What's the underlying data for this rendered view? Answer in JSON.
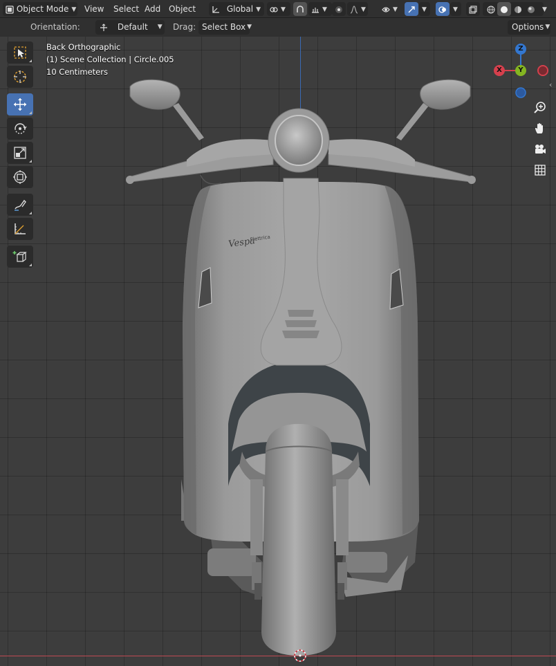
{
  "header": {
    "mode": "Object Mode",
    "menus": [
      "View",
      "Select",
      "Add",
      "Object"
    ],
    "transform_orientation": "Global",
    "icons": [
      "editor-type-icon",
      "object-mode-icon",
      "transform-orientation-icon",
      "pivot-icon",
      "snap-icon",
      "snap-increment-icon",
      "proportional-icon",
      "falloff-icon",
      "visibility-icon",
      "gizmo-icon",
      "overlay-icon",
      "xray-icon",
      "shading-wireframe-icon",
      "shading-solid-icon",
      "shading-material-icon",
      "shading-rendered-icon"
    ]
  },
  "tool_settings": {
    "orientation_label": "Orientation:",
    "orientation_value": "Default",
    "drag_label": "Drag:",
    "drag_value": "Select Box",
    "options_label": "Options"
  },
  "viewport": {
    "view_name": "Back Orthographic",
    "collection_info": "(1) Scene Collection | Circle.005",
    "scale_info": "10 Centimeters",
    "gizmo": {
      "z": "Z",
      "x": "X",
      "y": "Y"
    },
    "colors": {
      "x": "#d6404d",
      "y": "#84b521",
      "z": "#3377d0",
      "active_tool": "#4772b3"
    }
  },
  "tools": [
    "select-box-icon",
    "cursor-icon",
    "move-icon",
    "rotate-icon",
    "scale-icon",
    "transform-icon",
    "annotate-icon",
    "measure-icon",
    "add-cube-icon"
  ],
  "nav": [
    "zoom-icon",
    "pan-hand-icon",
    "camera-icon",
    "grid-view-icon"
  ]
}
